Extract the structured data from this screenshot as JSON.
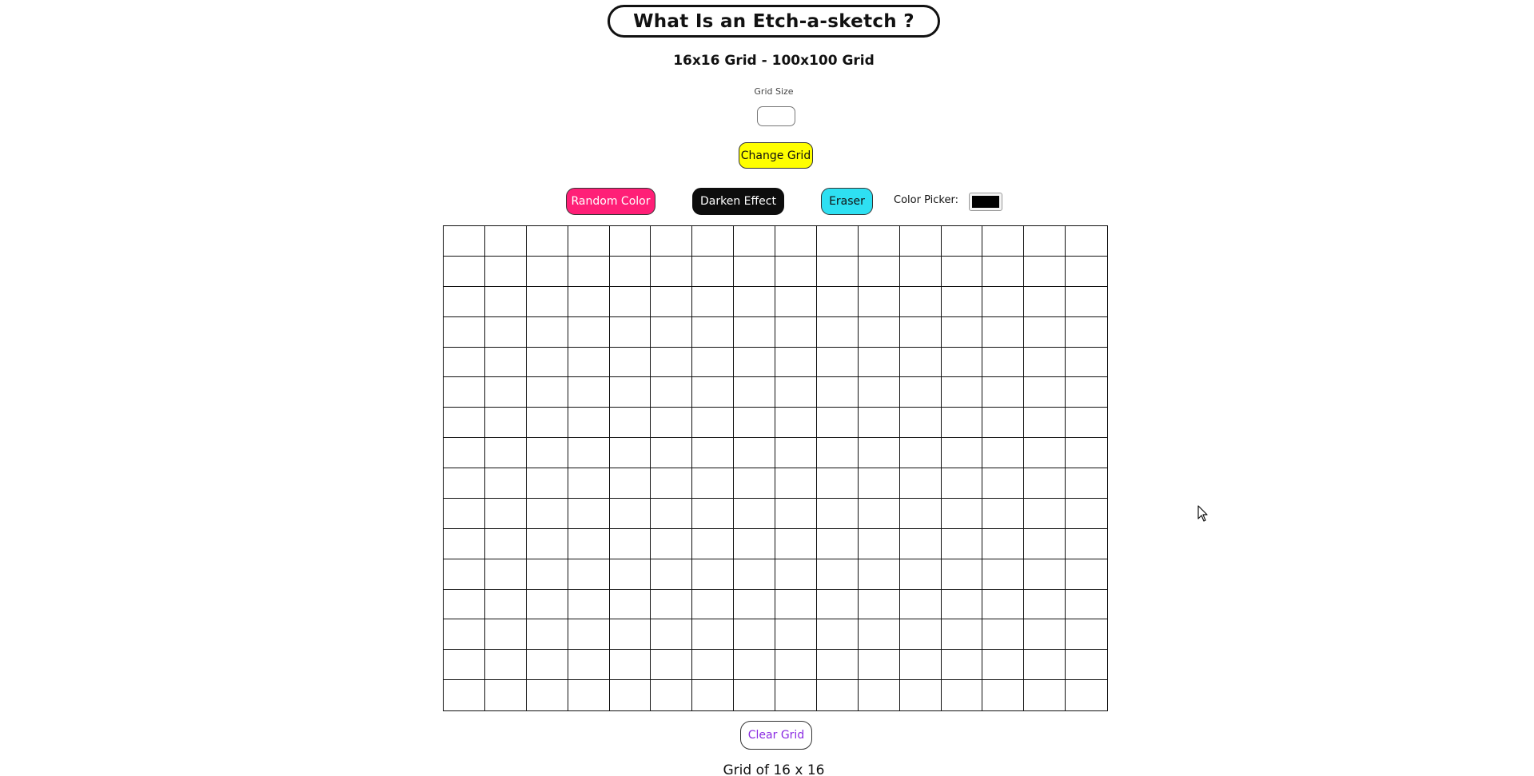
{
  "header": {
    "title": "What Is an Etch-a-sketch ?",
    "subtitle": "16x16 Grid - 100x100 Grid"
  },
  "controls": {
    "grid_size_label": "Grid Size",
    "grid_size_value": "",
    "change_grid_label": "Change Grid",
    "random_color_label": "Random Color",
    "darken_effect_label": "Darken Effect",
    "eraser_label": "Eraser",
    "color_picker_label": "Color Picker:",
    "color_picker_value": "#000000"
  },
  "grid": {
    "rows": 16,
    "columns": 16,
    "cell_color": "#ffffff",
    "line_color": "#111111"
  },
  "footer": {
    "clear_grid_label": "Clear Grid",
    "status_text": "Grid of 16 x 16"
  },
  "colors": {
    "change_grid_bg": "#ffff00",
    "random_color_bg": "#ff1f77",
    "darken_effect_bg": "#0d0d0d",
    "eraser_bg": "#2ee0f2",
    "clear_grid_text": "#8a2be2"
  }
}
